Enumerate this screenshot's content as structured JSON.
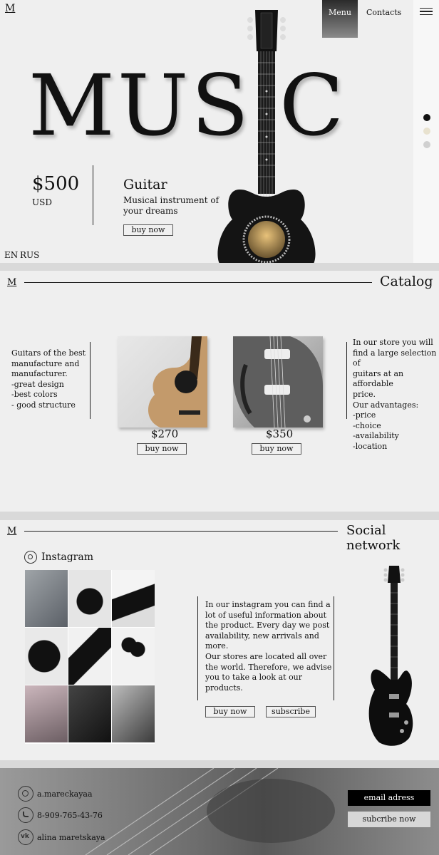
{
  "header": {
    "logo": "M",
    "menu_label": "Menu",
    "contacts_label": "Contacts"
  },
  "hero": {
    "title_left": "MUS",
    "title_right": "C",
    "price": "$500",
    "currency": "USD",
    "product_name": "Guitar",
    "product_desc_line1": "Musical instrument of",
    "product_desc_line2": "your dreams",
    "buy_label": "buy now",
    "languages": [
      "EN",
      "RUS"
    ]
  },
  "catalog": {
    "logo": "M",
    "title": "Catalog",
    "left_text": [
      "Guitars of the best",
      "manufacture and",
      "manufacturer.",
      "-great design",
      "-best colors",
      "- good structure"
    ],
    "products": [
      {
        "price": "$270",
        "buy_label": "buy now"
      },
      {
        "price": "$350",
        "buy_label": "buy now"
      }
    ],
    "right_text": [
      "In our store you will",
      "find a large selection of",
      "guitars at an affordable",
      "price.",
      "Our advantages:",
      "-price",
      "-choice",
      "-availability",
      "-location"
    ]
  },
  "social": {
    "logo": "M",
    "title": "Social network",
    "instagram_label": "Instagram",
    "text": [
      "In our instagram you can find a",
      "lot of useful information about",
      "the product. Every day we post",
      "availability, new arrivals and",
      "more.",
      "Our stores are located all over",
      "the world. Therefore, we advise",
      "you to take a look at our",
      "products."
    ],
    "buy_label": "buy now",
    "subscribe_label": "subscribe"
  },
  "footer": {
    "contacts": [
      {
        "icon": "instagram-icon",
        "text": "a.mareckayaa"
      },
      {
        "icon": "whatsapp-icon",
        "text": "8-909-765-43-76"
      },
      {
        "icon": "vk-icon",
        "text": "alina maretskaya"
      }
    ],
    "email_placeholder": "email adress",
    "subscribe_label": "subcribe now"
  },
  "colors": {
    "page_bg": "#efefef",
    "divider_bg": "#d9d9d9",
    "menu_bg": "#3a3a3a",
    "footer_bg": "#7a7a7a"
  }
}
